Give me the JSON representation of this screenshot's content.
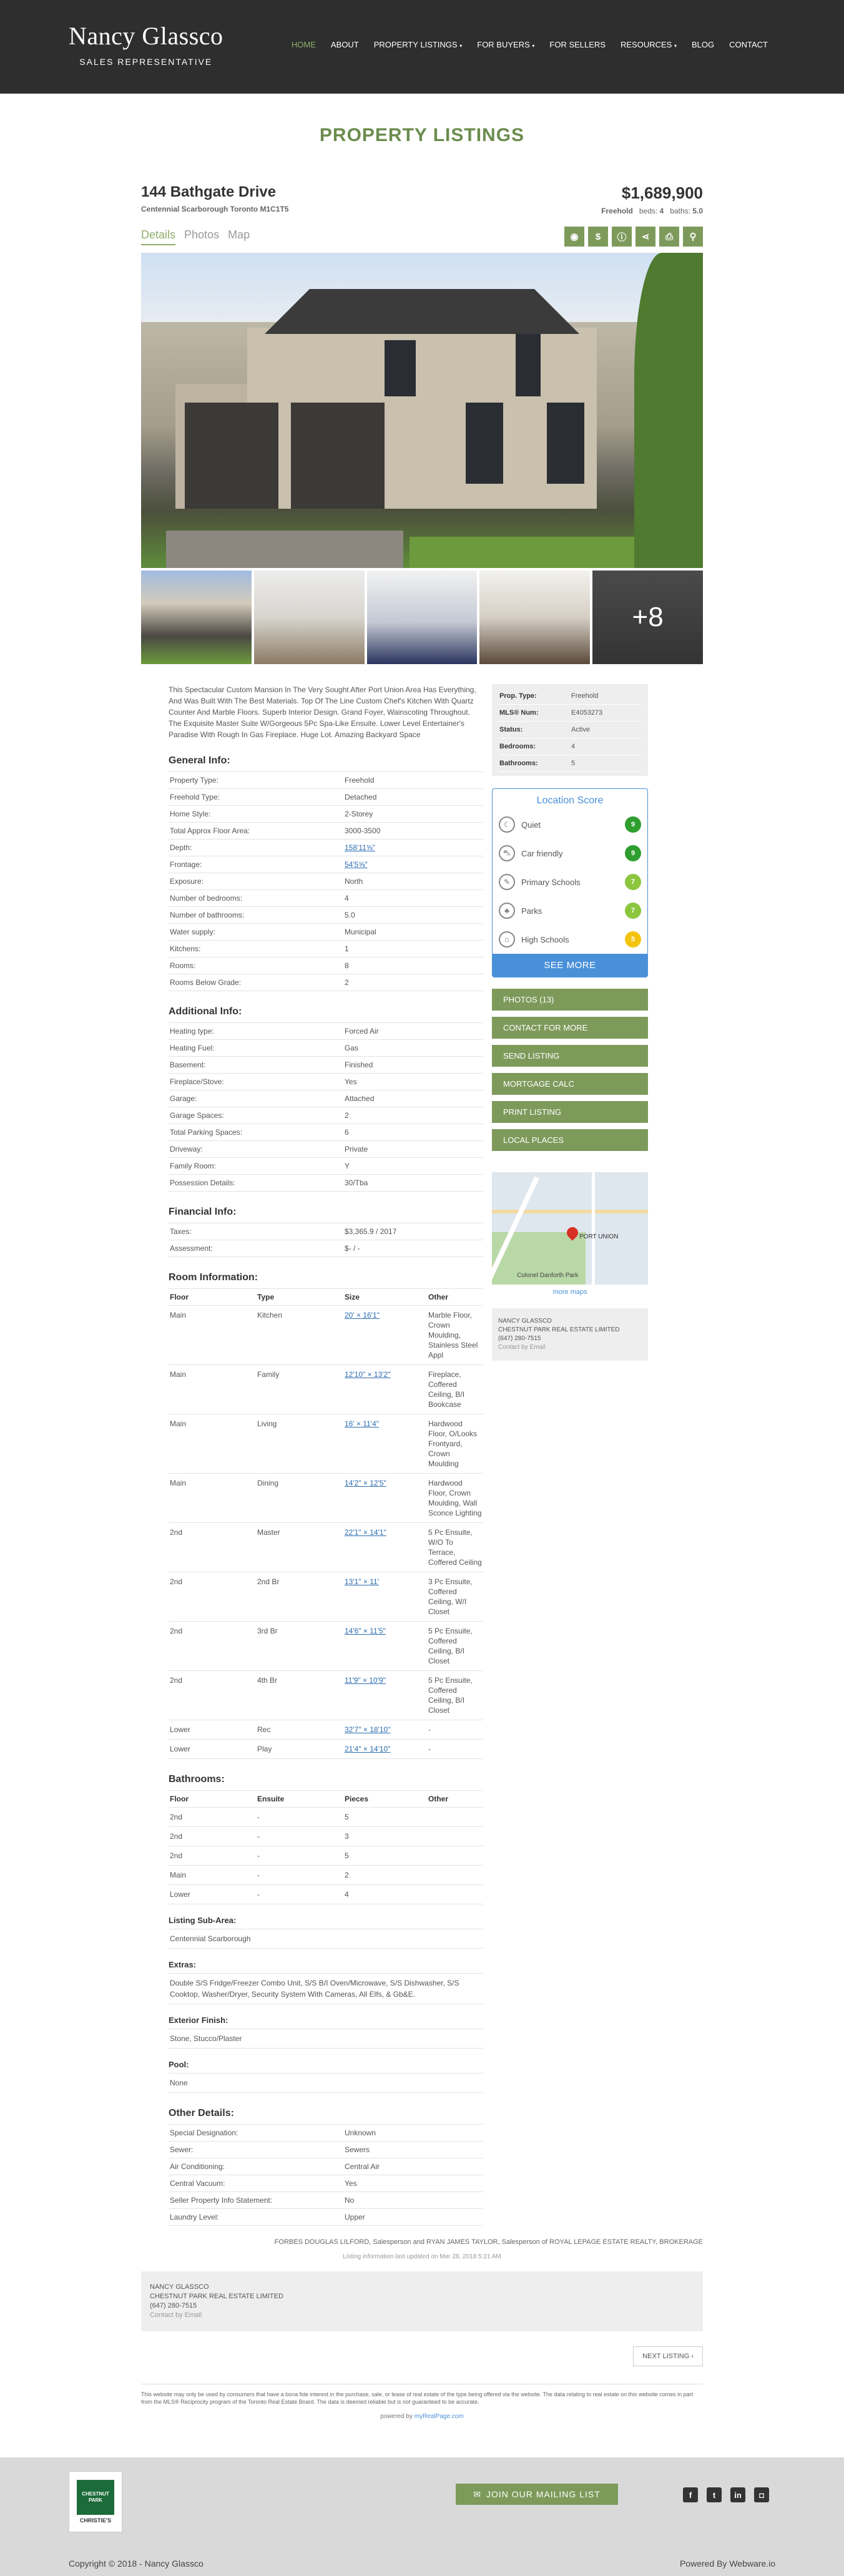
{
  "header": {
    "brand_name": "Nancy Glassco",
    "brand_sub": "SALES REPRESENTATIVE",
    "nav": [
      "HOME",
      "ABOUT",
      "PROPERTY LISTINGS",
      "FOR BUYERS",
      "FOR SELLERS",
      "RESOURCES",
      "BLOG",
      "CONTACT"
    ]
  },
  "page_title": "PROPERTY LISTINGS",
  "listing": {
    "address": "144 Bathgate Drive",
    "area": "Centennial Scarborough  Toronto  M1C1T5",
    "price": "$1,689,900",
    "tenure": "Freehold",
    "beds_label": "beds:",
    "beds": "4",
    "baths_label": "baths:",
    "baths": "5.0"
  },
  "tabs": [
    "Details",
    "Photos",
    "Map"
  ],
  "tool_icons": [
    "camera-icon",
    "dollar-icon",
    "info-icon",
    "share-icon",
    "print-icon",
    "map-pin-icon"
  ],
  "thumbs_more": "+8",
  "description": "This Spectacular Custom Mansion In The Very Sought After Port Union Area Has Everything, And Was Built With The Best Materials. Top Of The Line Custom Chef's Kitchen With Quartz Counter And Marble Floors. Superb Interior Design. Grand Foyer, Wainscoting Throughout. The Exquisite Master Suite W/Gorgeous 5Pc Spa-Like Ensuite. Lower Level Entertainer's Paradise With Rough In Gas Fireplace. Huge Lot. Amazing Backyard Space",
  "general": {
    "title": "General Info:",
    "rows": [
      [
        "Property Type:",
        "Freehold"
      ],
      [
        "Freehold Type:",
        "Detached"
      ],
      [
        "Home Style:",
        "2-Storey"
      ],
      [
        "Total Approx Floor Area:",
        "3000-3500"
      ],
      [
        "Depth:",
        "158'11⅝\""
      ],
      [
        "Frontage:",
        "54'5⅝\""
      ],
      [
        "Exposure:",
        "North"
      ],
      [
        "Number of bedrooms:",
        "4"
      ],
      [
        "Number of bathrooms:",
        "5.0"
      ],
      [
        "Water supply:",
        "Municipal"
      ],
      [
        "Kitchens:",
        "1"
      ],
      [
        "Rooms:",
        "8"
      ],
      [
        "Rooms Below Grade:",
        "2"
      ]
    ]
  },
  "additional": {
    "title": "Additional Info:",
    "rows": [
      [
        "Heating type:",
        "Forced Air"
      ],
      [
        "Heating Fuel:",
        "Gas"
      ],
      [
        "Basement:",
        "Finished"
      ],
      [
        "Fireplace/Stove:",
        "Yes"
      ],
      [
        "Garage:",
        "Attached"
      ],
      [
        "Garage Spaces:",
        "2"
      ],
      [
        "Total Parking Spaces:",
        "6"
      ],
      [
        "Driveway:",
        "Private"
      ],
      [
        "Family Room:",
        "Y"
      ],
      [
        "Possession Details:",
        "30/Tba"
      ]
    ]
  },
  "financial": {
    "title": "Financial Info:",
    "rows": [
      [
        "Taxes:",
        "$3,365.9 / 2017"
      ],
      [
        "Assessment:",
        "$- / -"
      ]
    ]
  },
  "rooms": {
    "title": "Room Information:",
    "headers": [
      "Floor",
      "Type",
      "Size",
      "Other"
    ],
    "rows": [
      [
        "Main",
        "Kitchen",
        "20' × 16'1\"",
        "Marble Floor, Crown Moulding, Stainless Steel Appl"
      ],
      [
        "Main",
        "Family",
        "12'10\" × 13'2\"",
        "Fireplace, Coffered Ceiling, B/I Bookcase"
      ],
      [
        "Main",
        "Living",
        "16' × 11'4\"",
        "Hardwood Floor, O/Looks Frontyard, Crown Moulding"
      ],
      [
        "Main",
        "Dining",
        "14'2\" × 12'5\"",
        "Hardwood Floor, Crown Moulding, Wall Sconce Lighting"
      ],
      [
        "2nd",
        "Master",
        "22'1\" × 14'1\"",
        "5 Pc Ensuite, W/O To Terrace, Coffered Ceiling"
      ],
      [
        "2nd",
        "2nd Br",
        "13'1\" × 11'",
        "3 Pc Ensuite, Coffered Ceiling, W/I Closet"
      ],
      [
        "2nd",
        "3rd Br",
        "14'6\" × 11'5\"",
        "5 Pc Ensuite, Coffered Ceiling, B/I Closet"
      ],
      [
        "2nd",
        "4th Br",
        "11'9\" × 10'9\"",
        "5 Pc Ensuite, Coffered Ceiling, B/I Closet"
      ],
      [
        "Lower",
        "Rec",
        "32'7\" × 18'10\"",
        "-"
      ],
      [
        "Lower",
        "Play",
        "21'4\" × 14'10\"",
        "-"
      ]
    ]
  },
  "bathrooms": {
    "title": "Bathrooms:",
    "headers": [
      "Floor",
      "Ensuite",
      "Pieces",
      "Other"
    ],
    "rows": [
      [
        "2nd",
        "-",
        "5",
        ""
      ],
      [
        "2nd",
        "-",
        "3",
        ""
      ],
      [
        "2nd",
        "-",
        "5",
        ""
      ],
      [
        "Main",
        "-",
        "2",
        ""
      ],
      [
        "Lower",
        "-",
        "4",
        ""
      ]
    ]
  },
  "sub_area": {
    "title": "Listing Sub-Area:",
    "value": "Centennial Scarborough"
  },
  "extras": {
    "title": "Extras:",
    "value": "Double S/S Fridge/Freezer Combo Unit, S/S B/I Oven/Microwave, S/S Dishwasher, S/S Cooktop, Washer/Dryer, Security System With Cameras, All Elfs, & Gb&E."
  },
  "exterior": {
    "title": "Exterior Finish:",
    "value": "Stone, Stucco/Plaster"
  },
  "pool": {
    "title": "Pool:",
    "value": "None"
  },
  "other": {
    "title": "Other Details:",
    "rows": [
      [
        "Special Designation:",
        "Unknown"
      ],
      [
        "Sewer:",
        "Sewers"
      ],
      [
        "Air Conditioning:",
        "Central Air"
      ],
      [
        "Central Vacuum:",
        "Yes"
      ],
      [
        "Seller Property Info Statement:",
        "No"
      ],
      [
        "Laundry Level:",
        "Upper"
      ]
    ]
  },
  "sidebar": {
    "prop_rows": [
      [
        "Prop. Type:",
        "Freehold"
      ],
      [
        "MLS® Num:",
        "E4053273"
      ],
      [
        "Status:",
        "Active"
      ],
      [
        "Bedrooms:",
        "4"
      ],
      [
        "Bathrooms:",
        "5"
      ]
    ],
    "location_score": {
      "title": "Location Score",
      "rows": [
        {
          "label": "Quiet",
          "score": "9",
          "color": "#2e9e2e",
          "icon": "quiet-icon"
        },
        {
          "label": "Car friendly",
          "score": "9",
          "color": "#2e9e2e",
          "icon": "car-icon"
        },
        {
          "label": "Primary Schools",
          "score": "7",
          "color": "#8cc63f",
          "icon": "school-icon"
        },
        {
          "label": "Parks",
          "score": "7",
          "color": "#8cc63f",
          "icon": "park-icon"
        },
        {
          "label": "High Schools",
          "score": "5",
          "color": "#f2c40f",
          "icon": "high-school-icon"
        }
      ],
      "more": "SEE MORE"
    },
    "buttons": [
      "PHOTOS (13)",
      "CONTACT FOR MORE",
      "SEND LISTING",
      "MORTGAGE CALC",
      "PRINT LISTING",
      "LOCAL PLACES"
    ],
    "map_label": "PORT UNION",
    "map_label2": "Colonel Danforth Park",
    "more_maps": "more maps",
    "agent": {
      "name": "NANCY GLASSCO",
      "company": "CHESTNUT PARK REAL ESTATE LIMITED",
      "phone": "(647) 280-7515",
      "email_link": "Contact by Email"
    }
  },
  "brokerage": "FORBES DOUGLAS LILFORD, Salesperson and RYAN JAMES TAYLOR, Salesperson of ROYAL LEPAGE ESTATE REALTY, BROKERAGE",
  "updated": "Listing information last updated on Mar 28, 2018 5:21 AM",
  "agent_footer": {
    "name": "NANCY GLASSCO",
    "company": "CHESTNUT PARK REAL ESTATE LIMITED",
    "phone": "(647) 280-7515",
    "email_link": "Contact by Email"
  },
  "next_listing": "NEXT LISTING ›",
  "disclaimer": "This website may only be used by consumers that have a bona fide interest in the purchase, sale, or lease of real estate of the type being offered via the website. The data relating to real estate on this website comes in part from the MLS® Reciprocity program of the Toronto Real Estate Board. The data is deemed reliable but is not guaranteed to be accurate.",
  "powered": {
    "prefix": "powered by",
    "link": "myRealPage.com"
  },
  "footer": {
    "logo_text": "CHESTNUT PARK",
    "logo_sub": "CHRISTIE'S",
    "mailing_button": "JOIN OUR MAILING LIST",
    "socials": [
      "facebook-icon",
      "twitter-icon",
      "linkedin-icon",
      "instagram-icon"
    ],
    "copyright": "Copyright © 2018 - Nancy Glassco",
    "powered": "Powered By Webware.io"
  }
}
